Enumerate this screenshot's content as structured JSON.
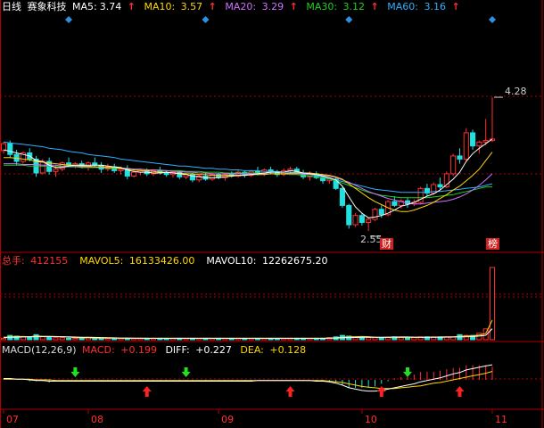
{
  "header": {
    "period": "日线",
    "stock_name": "赛象科技",
    "ma": [
      {
        "label": "MA5:",
        "value": "3.74",
        "color": "#ffffff"
      },
      {
        "label": "MA10:",
        "value": "3.57",
        "color": "#ffd700"
      },
      {
        "label": "MA20:",
        "value": "3.29",
        "color": "#d070ff"
      },
      {
        "label": "MA30:",
        "value": "3.12",
        "color": "#20d020"
      },
      {
        "label": "MA60:",
        "value": "3.16",
        "color": "#30b0ff"
      }
    ],
    "arrow": "↑"
  },
  "volume_header": {
    "total_label": "总手:",
    "total_value": "412155",
    "mavol5_label": "MAVOL5:",
    "mavol5_value": "16133426.00",
    "mavol10_label": "MAVOL10:",
    "mavol10_value": "12262675.20"
  },
  "macd_header": {
    "title": "MACD(12,26,9)",
    "macd_label": "MACD:",
    "macd_value": "+0.199",
    "diff_label": "DIFF:",
    "diff_value": "+0.227",
    "dea_label": "DEA:",
    "dea_value": "+0.128"
  },
  "annotations": {
    "high_price": "4.28",
    "low_price": "2.55",
    "tag_cai": "财",
    "tag_bang": "榜"
  },
  "colors": {
    "up": "#ff3030",
    "down": "#20e0e0",
    "axis": "#b00000",
    "ma5": "#ffffff",
    "ma10": "#ffd700",
    "ma20": "#d070ff",
    "ma30": "#20d020",
    "ma60": "#30b0ff",
    "diamond": "#3090e0",
    "macd_up_arrow": "#ff2020",
    "macd_down_arrow": "#20e020"
  },
  "chart_data": {
    "type": "candlestick",
    "x_labels": [
      "07",
      "08",
      "09",
      "10",
      "11"
    ],
    "x_label_index": [
      0,
      13,
      33,
      55,
      75
    ],
    "price_range": [
      2.4,
      4.5
    ],
    "candles": [
      [
        3.59,
        3.7,
        3.55,
        3.68
      ],
      [
        3.68,
        3.72,
        3.5,
        3.54
      ],
      [
        3.54,
        3.6,
        3.4,
        3.45
      ],
      [
        3.45,
        3.58,
        3.42,
        3.56
      ],
      [
        3.56,
        3.62,
        3.45,
        3.48
      ],
      [
        3.48,
        3.52,
        3.25,
        3.3
      ],
      [
        3.3,
        3.48,
        3.28,
        3.45
      ],
      [
        3.45,
        3.5,
        3.28,
        3.32
      ],
      [
        3.32,
        3.4,
        3.25,
        3.35
      ],
      [
        3.35,
        3.45,
        3.32,
        3.43
      ],
      [
        3.43,
        3.5,
        3.38,
        3.4
      ],
      [
        3.4,
        3.44,
        3.36,
        3.42
      ],
      [
        3.42,
        3.46,
        3.36,
        3.38
      ],
      [
        3.38,
        3.45,
        3.33,
        3.43
      ],
      [
        3.43,
        3.5,
        3.38,
        3.4
      ],
      [
        3.4,
        3.44,
        3.3,
        3.35
      ],
      [
        3.35,
        3.42,
        3.32,
        3.38
      ],
      [
        3.38,
        3.42,
        3.3,
        3.33
      ],
      [
        3.33,
        3.38,
        3.28,
        3.35
      ],
      [
        3.35,
        3.4,
        3.22,
        3.26
      ],
      [
        3.26,
        3.34,
        3.24,
        3.31
      ],
      [
        3.31,
        3.36,
        3.27,
        3.34
      ],
      [
        3.34,
        3.36,
        3.26,
        3.29
      ],
      [
        3.29,
        3.35,
        3.26,
        3.33
      ],
      [
        3.33,
        3.38,
        3.28,
        3.3
      ],
      [
        3.3,
        3.34,
        3.25,
        3.28
      ],
      [
        3.28,
        3.33,
        3.24,
        3.31
      ],
      [
        3.31,
        3.33,
        3.22,
        3.25
      ],
      [
        3.25,
        3.3,
        3.22,
        3.28
      ],
      [
        3.28,
        3.3,
        3.18,
        3.21
      ],
      [
        3.21,
        3.28,
        3.18,
        3.26
      ],
      [
        3.26,
        3.3,
        3.2,
        3.22
      ],
      [
        3.22,
        3.3,
        3.2,
        3.28
      ],
      [
        3.28,
        3.3,
        3.22,
        3.24
      ],
      [
        3.24,
        3.3,
        3.2,
        3.28
      ],
      [
        3.28,
        3.32,
        3.24,
        3.26
      ],
      [
        3.26,
        3.34,
        3.24,
        3.31
      ],
      [
        3.31,
        3.33,
        3.24,
        3.27
      ],
      [
        3.27,
        3.34,
        3.25,
        3.32
      ],
      [
        3.32,
        3.38,
        3.27,
        3.3
      ],
      [
        3.3,
        3.36,
        3.26,
        3.34
      ],
      [
        3.34,
        3.38,
        3.28,
        3.31
      ],
      [
        3.31,
        3.34,
        3.25,
        3.28
      ],
      [
        3.28,
        3.36,
        3.26,
        3.33
      ],
      [
        3.33,
        3.38,
        3.3,
        3.35
      ],
      [
        3.35,
        3.38,
        3.28,
        3.3
      ],
      [
        3.3,
        3.34,
        3.22,
        3.25
      ],
      [
        3.25,
        3.32,
        3.2,
        3.29
      ],
      [
        3.29,
        3.32,
        3.22,
        3.24
      ],
      [
        3.24,
        3.26,
        3.16,
        3.2
      ],
      [
        3.2,
        3.24,
        3.16,
        3.22
      ],
      [
        3.22,
        3.25,
        3.08,
        3.1
      ],
      [
        3.1,
        3.12,
        2.85,
        2.88
      ],
      [
        2.88,
        2.9,
        2.58,
        2.63
      ],
      [
        2.63,
        2.78,
        2.6,
        2.75
      ],
      [
        2.75,
        2.78,
        2.62,
        2.66
      ],
      [
        2.66,
        2.72,
        2.55,
        2.7
      ],
      [
        2.7,
        2.85,
        2.68,
        2.83
      ],
      [
        2.83,
        2.88,
        2.72,
        2.76
      ],
      [
        2.76,
        2.95,
        2.74,
        2.93
      ],
      [
        2.93,
        3.0,
        2.86,
        2.88
      ],
      [
        2.88,
        2.96,
        2.84,
        2.94
      ],
      [
        2.94,
        2.98,
        2.85,
        2.9
      ],
      [
        2.9,
        2.96,
        2.87,
        2.92
      ],
      [
        2.92,
        3.12,
        2.9,
        3.1
      ],
      [
        3.1,
        3.16,
        3.0,
        3.04
      ],
      [
        3.04,
        3.18,
        3.02,
        3.15
      ],
      [
        3.15,
        3.24,
        3.08,
        3.12
      ],
      [
        3.12,
        3.32,
        3.1,
        3.29
      ],
      [
        3.29,
        3.55,
        3.26,
        3.52
      ],
      [
        3.52,
        3.62,
        3.42,
        3.48
      ],
      [
        3.48,
        3.88,
        3.45,
        3.82
      ],
      [
        3.82,
        3.86,
        3.6,
        3.65
      ],
      [
        3.65,
        3.72,
        3.55,
        3.7
      ],
      [
        3.7,
        4.0,
        3.66,
        3.72
      ],
      [
        3.72,
        4.28,
        3.7,
        3.74
      ]
    ],
    "ma5": [
      3.6,
      3.58,
      3.56,
      3.54,
      3.52,
      3.46,
      3.45,
      3.4,
      3.37,
      3.37,
      3.39,
      3.4,
      3.4,
      3.4,
      3.4,
      3.4,
      3.39,
      3.38,
      3.37,
      3.34,
      3.32,
      3.31,
      3.31,
      3.3,
      3.3,
      3.31,
      3.3,
      3.29,
      3.28,
      3.26,
      3.25,
      3.24,
      3.24,
      3.24,
      3.25,
      3.26,
      3.27,
      3.27,
      3.28,
      3.29,
      3.3,
      3.31,
      3.31,
      3.31,
      3.33,
      3.32,
      3.3,
      3.29,
      3.28,
      3.26,
      3.24,
      3.21,
      3.13,
      2.99,
      2.86,
      2.78,
      2.72,
      2.73,
      2.75,
      2.78,
      2.82,
      2.87,
      2.89,
      2.92,
      2.96,
      3.0,
      3.03,
      3.08,
      3.15,
      3.22,
      3.31,
      3.45,
      3.55,
      3.62,
      3.68,
      3.74
    ],
    "ma10": [
      3.5,
      3.5,
      3.49,
      3.48,
      3.47,
      3.45,
      3.44,
      3.43,
      3.42,
      3.41,
      3.4,
      3.4,
      3.39,
      3.39,
      3.38,
      3.38,
      3.37,
      3.37,
      3.36,
      3.35,
      3.34,
      3.33,
      3.33,
      3.32,
      3.31,
      3.31,
      3.3,
      3.3,
      3.29,
      3.29,
      3.28,
      3.28,
      3.27,
      3.27,
      3.27,
      3.27,
      3.27,
      3.27,
      3.28,
      3.28,
      3.28,
      3.29,
      3.29,
      3.29,
      3.3,
      3.3,
      3.3,
      3.3,
      3.29,
      3.28,
      3.27,
      3.25,
      3.22,
      3.16,
      3.1,
      3.04,
      2.98,
      2.93,
      2.89,
      2.85,
      2.82,
      2.8,
      2.8,
      2.82,
      2.85,
      2.88,
      2.92,
      2.97,
      3.02,
      3.08,
      3.13,
      3.2,
      3.27,
      3.35,
      3.46,
      3.57
    ],
    "ma20": [
      3.42,
      3.42,
      3.42,
      3.41,
      3.41,
      3.41,
      3.4,
      3.4,
      3.4,
      3.39,
      3.39,
      3.39,
      3.38,
      3.38,
      3.38,
      3.37,
      3.37,
      3.37,
      3.36,
      3.36,
      3.35,
      3.35,
      3.34,
      3.34,
      3.33,
      3.33,
      3.32,
      3.32,
      3.31,
      3.31,
      3.3,
      3.3,
      3.29,
      3.29,
      3.29,
      3.29,
      3.29,
      3.29,
      3.29,
      3.29,
      3.29,
      3.29,
      3.29,
      3.29,
      3.29,
      3.29,
      3.29,
      3.28,
      3.28,
      3.27,
      3.26,
      3.24,
      3.21,
      3.18,
      3.14,
      3.1,
      3.06,
      3.03,
      3.0,
      2.97,
      2.95,
      2.93,
      2.91,
      2.9,
      2.9,
      2.91,
      2.92,
      2.93,
      2.94,
      2.96,
      2.99,
      3.03,
      3.08,
      3.14,
      3.21,
      3.29
    ],
    "ma30": [
      3.4,
      3.4,
      3.4,
      3.4,
      3.39,
      3.39,
      3.39,
      3.39,
      3.38,
      3.38,
      3.38,
      3.38,
      3.37,
      3.37,
      3.37,
      3.37,
      3.36,
      3.36,
      3.36,
      3.35,
      3.35,
      3.35,
      3.34,
      3.34,
      3.34,
      3.33,
      3.33,
      3.33,
      3.32,
      3.32,
      3.32,
      3.31,
      3.31,
      3.31,
      3.3,
      3.3,
      3.3,
      3.3,
      3.3,
      3.3,
      3.29,
      3.29,
      3.29,
      3.29,
      3.28,
      3.28,
      3.27,
      3.26,
      3.25,
      3.24,
      3.22,
      3.2,
      3.17,
      3.14,
      3.11,
      3.08,
      3.05,
      3.03,
      3.01,
      3.0,
      2.99,
      2.98,
      2.98,
      2.98,
      2.98,
      2.98,
      2.99,
      3.0,
      3.01,
      3.02,
      3.04,
      3.06,
      3.08,
      3.1,
      3.12,
      3.12
    ],
    "ma60": [
      3.7,
      3.69,
      3.68,
      3.67,
      3.66,
      3.65,
      3.64,
      3.62,
      3.61,
      3.6,
      3.58,
      3.57,
      3.56,
      3.54,
      3.53,
      3.52,
      3.51,
      3.5,
      3.48,
      3.47,
      3.46,
      3.45,
      3.44,
      3.43,
      3.42,
      3.41,
      3.4,
      3.39,
      3.39,
      3.38,
      3.37,
      3.36,
      3.36,
      3.35,
      3.35,
      3.34,
      3.34,
      3.33,
      3.33,
      3.33,
      3.32,
      3.32,
      3.32,
      3.31,
      3.31,
      3.3,
      3.29,
      3.28,
      3.27,
      3.25,
      3.23,
      3.21,
      3.19,
      3.17,
      3.15,
      3.13,
      3.11,
      3.09,
      3.08,
      3.07,
      3.06,
      3.05,
      3.05,
      3.05,
      3.05,
      3.05,
      3.06,
      3.06,
      3.07,
      3.08,
      3.09,
      3.1,
      3.11,
      3.12,
      3.14,
      3.16
    ],
    "volume": [
      2,
      6,
      5,
      4,
      4,
      7,
      4,
      4,
      3,
      3,
      2,
      2,
      2,
      3,
      2,
      2,
      2,
      2,
      2,
      2,
      2,
      2,
      2,
      2,
      2,
      2,
      2,
      2,
      2,
      2,
      2,
      2,
      2,
      2,
      2,
      2,
      2,
      2,
      2,
      2,
      2,
      2,
      2,
      2,
      2,
      2,
      2,
      2,
      2,
      2,
      3,
      4,
      6,
      5,
      3,
      4,
      3,
      3,
      3,
      3,
      4,
      3,
      3,
      3,
      4,
      4,
      4,
      4,
      4,
      4,
      7,
      6,
      6,
      9,
      15,
      100
    ],
    "volume_range": [
      0,
      100
    ],
    "mavol5": [
      3.5,
      4.1,
      4.5,
      4.4,
      4.2,
      5.2,
      4.8,
      4.6,
      4.4,
      4.2,
      3.6,
      3.0,
      2.6,
      2.6,
      2.4,
      2.2,
      2.2,
      2.2,
      2.0,
      2.0,
      2.0,
      2.0,
      2.0,
      2.0,
      2.0,
      2.0,
      2.0,
      2.0,
      2.0,
      2.0,
      2.0,
      2.0,
      2.0,
      2.0,
      2.0,
      2.0,
      2.0,
      2.0,
      2.0,
      2.0,
      2.0,
      2.0,
      2.0,
      2.0,
      2.0,
      2.0,
      2.0,
      2.0,
      2.0,
      2.0,
      2.2,
      2.6,
      3.4,
      4.0,
      4.2,
      4.4,
      4.2,
      3.6,
      3.2,
      3.2,
      3.2,
      3.2,
      3.2,
      3.2,
      3.4,
      3.6,
      3.6,
      3.8,
      4.0,
      4.0,
      4.6,
      5.0,
      5.4,
      6.4,
      8.6,
      27.2
    ],
    "mavol10": [
      3.0,
      3.3,
      3.6,
      3.8,
      3.9,
      4.2,
      4.3,
      4.4,
      4.3,
      4.2,
      4.1,
      3.7,
      3.4,
      3.4,
      3.2,
      3.0,
      2.8,
      2.6,
      2.4,
      2.3,
      2.2,
      2.1,
      2.0,
      2.0,
      2.0,
      2.0,
      2.0,
      2.0,
      2.0,
      2.0,
      2.0,
      2.0,
      2.0,
      2.0,
      2.0,
      2.0,
      2.0,
      2.0,
      2.0,
      2.0,
      2.0,
      2.0,
      2.0,
      2.0,
      2.0,
      2.0,
      2.0,
      2.0,
      2.0,
      2.0,
      2.1,
      2.3,
      2.7,
      3.0,
      3.1,
      3.3,
      3.3,
      3.4,
      3.5,
      3.6,
      3.7,
      3.8,
      3.8,
      3.6,
      3.4,
      3.4,
      3.4,
      3.5,
      3.6,
      3.7,
      3.9,
      4.1,
      4.4,
      5.0,
      6.2,
      15.3
    ],
    "macd_range": [
      -0.35,
      0.35
    ],
    "diff": [
      0.02,
      0.02,
      0.01,
      0.01,
      0.0,
      -0.01,
      -0.01,
      -0.02,
      -0.02,
      -0.02,
      -0.02,
      -0.02,
      -0.02,
      -0.02,
      -0.02,
      -0.02,
      -0.02,
      -0.02,
      -0.02,
      -0.02,
      -0.02,
      -0.02,
      -0.02,
      -0.02,
      -0.02,
      -0.02,
      -0.02,
      -0.02,
      -0.02,
      -0.02,
      -0.02,
      -0.02,
      -0.02,
      -0.02,
      -0.02,
      -0.02,
      -0.02,
      -0.02,
      -0.02,
      -0.01,
      -0.01,
      -0.01,
      -0.01,
      -0.01,
      -0.01,
      -0.01,
      -0.01,
      -0.01,
      -0.02,
      -0.02,
      -0.03,
      -0.05,
      -0.08,
      -0.12,
      -0.14,
      -0.16,
      -0.17,
      -0.17,
      -0.16,
      -0.14,
      -0.12,
      -0.1,
      -0.08,
      -0.06,
      -0.03,
      -0.01,
      0.01,
      0.03,
      0.06,
      0.09,
      0.11,
      0.15,
      0.17,
      0.19,
      0.21,
      0.227
    ],
    "dea": [
      0.01,
      0.01,
      0.01,
      0.01,
      0.01,
      0.0,
      0.0,
      0.0,
      -0.01,
      -0.01,
      -0.01,
      -0.01,
      -0.01,
      -0.01,
      -0.01,
      -0.01,
      -0.01,
      -0.01,
      -0.01,
      -0.01,
      -0.01,
      -0.01,
      -0.01,
      -0.01,
      -0.01,
      -0.01,
      -0.01,
      -0.01,
      -0.01,
      -0.01,
      -0.01,
      -0.01,
      -0.01,
      -0.01,
      -0.01,
      -0.01,
      -0.01,
      -0.01,
      -0.01,
      -0.01,
      -0.01,
      -0.01,
      -0.01,
      -0.01,
      -0.01,
      -0.01,
      -0.01,
      -0.01,
      -0.01,
      -0.01,
      -0.02,
      -0.03,
      -0.04,
      -0.06,
      -0.08,
      -0.1,
      -0.11,
      -0.12,
      -0.13,
      -0.13,
      -0.13,
      -0.12,
      -0.11,
      -0.1,
      -0.09,
      -0.07,
      -0.05,
      -0.04,
      -0.02,
      0.0,
      0.02,
      0.04,
      0.06,
      0.08,
      0.1,
      0.128
    ],
    "macd_hist": [
      0.02,
      0.02,
      0.0,
      0.0,
      -0.02,
      -0.02,
      -0.02,
      -0.04,
      -0.02,
      -0.02,
      -0.02,
      -0.02,
      -0.02,
      -0.02,
      -0.02,
      -0.02,
      -0.02,
      -0.02,
      -0.02,
      -0.02,
      -0.02,
      -0.02,
      -0.02,
      -0.02,
      -0.02,
      -0.02,
      -0.02,
      -0.02,
      -0.02,
      -0.02,
      -0.02,
      -0.02,
      -0.02,
      -0.02,
      -0.02,
      -0.02,
      -0.02,
      -0.02,
      -0.02,
      0.0,
      0.0,
      0.0,
      0.0,
      0.0,
      0.0,
      0.0,
      0.0,
      0.0,
      -0.02,
      -0.02,
      -0.02,
      -0.04,
      -0.08,
      -0.12,
      -0.12,
      -0.12,
      -0.12,
      -0.1,
      -0.06,
      -0.02,
      0.02,
      0.04,
      0.06,
      0.08,
      0.12,
      0.12,
      0.12,
      0.14,
      0.16,
      0.18,
      0.18,
      0.22,
      0.22,
      0.22,
      0.22,
      0.199
    ],
    "signals_up": [
      22,
      44,
      58,
      70
    ],
    "signals_down": [
      11,
      28,
      62
    ],
    "diamonds": [
      10,
      31,
      53,
      75
    ]
  }
}
